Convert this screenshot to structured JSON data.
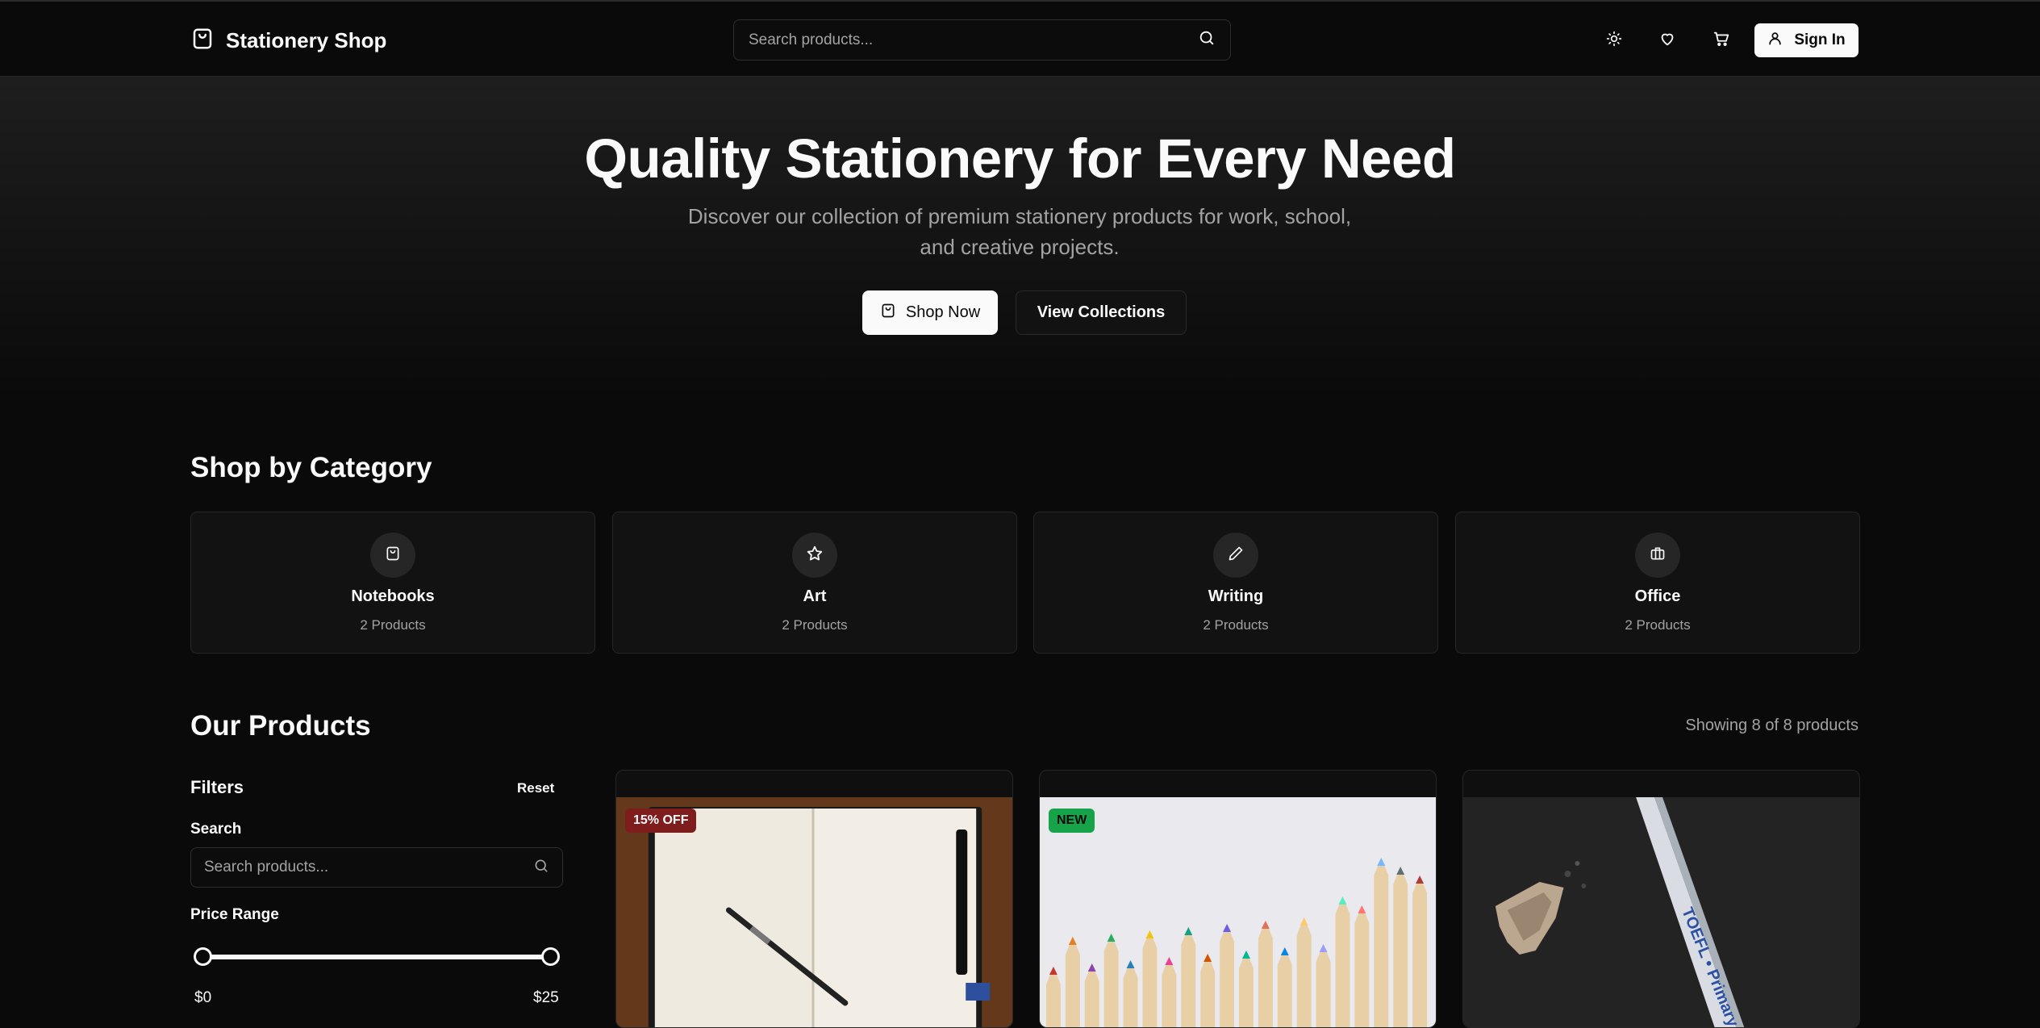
{
  "header": {
    "brand": "Stationery Shop",
    "search_placeholder": "Search products...",
    "icons": [
      "shopping-bag-icon",
      "search-icon",
      "sun-icon",
      "heart-icon",
      "cart-icon",
      "user-icon"
    ],
    "sign_in_label": "Sign In"
  },
  "hero": {
    "title": "Quality Stationery for Every Need",
    "subtitle": "Discover our collection of premium stationery products for work, school, and creative projects.",
    "shop_now_label": "Shop Now",
    "view_collections_label": "View Collections"
  },
  "categories": {
    "title": "Shop by Category",
    "items": [
      {
        "name": "Notebooks",
        "count": "2 Products",
        "icon": "shopping-bag-icon"
      },
      {
        "name": "Art",
        "count": "2 Products",
        "icon": "star-icon"
      },
      {
        "name": "Writing",
        "count": "2 Products",
        "icon": "pencil-icon"
      },
      {
        "name": "Office",
        "count": "2 Products",
        "icon": "briefcase-icon"
      }
    ]
  },
  "products": {
    "title": "Our Products",
    "showing": "Showing 8 of 8 products",
    "items": [
      {
        "badge": "15% OFF",
        "badge_color": "#7f1d1d",
        "image": "open notebook with pen on wooden desk"
      },
      {
        "badge": "NEW",
        "badge_color": "#16a34a",
        "image": "row of colored pencils"
      },
      {
        "badge": "",
        "image": "pencil and shavings on dark surface"
      }
    ]
  },
  "filters": {
    "title": "Filters",
    "reset_label": "Reset",
    "search_label": "Search",
    "search_placeholder": "Search products...",
    "price_label": "Price Range",
    "price_min": "$0",
    "price_max": "$25"
  },
  "colors": {
    "background": "#0a0a0a",
    "card": "#121212",
    "border": "#262626",
    "foreground": "#fafafa",
    "muted": "#a3a3a3"
  }
}
